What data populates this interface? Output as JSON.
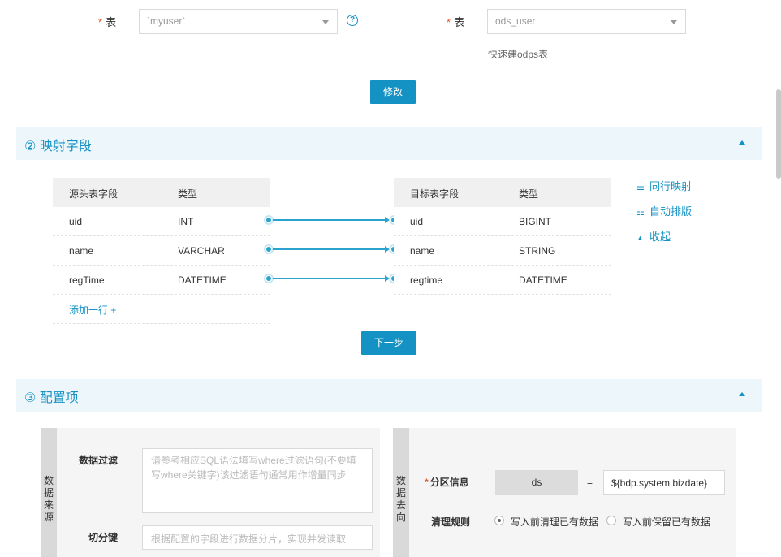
{
  "source": {
    "table_label": "表",
    "table_value": "`myuser`",
    "help_icon": "question-circle-icon"
  },
  "target": {
    "table_label": "表",
    "table_value": "ods_user",
    "quick_create_link": "快速建odps表"
  },
  "modify_button": "修改",
  "section2": {
    "title": "② 映射字段",
    "source_table": {
      "headers": [
        "源头表字段",
        "类型"
      ],
      "rows": [
        {
          "field": "uid",
          "type": "INT"
        },
        {
          "field": "name",
          "type": "VARCHAR"
        },
        {
          "field": "regTime",
          "type": "DATETIME"
        }
      ],
      "add_row": "添加一行 +"
    },
    "target_table": {
      "headers": [
        "目标表字段",
        "类型"
      ],
      "rows": [
        {
          "field": "uid",
          "type": "BIGINT"
        },
        {
          "field": "name",
          "type": "STRING"
        },
        {
          "field": "regtime",
          "type": "DATETIME"
        }
      ]
    },
    "actions": {
      "same_row_mapping": "同行映射",
      "auto_layout": "自动排版",
      "collapse": "收起"
    },
    "next_button": "下一步"
  },
  "section3": {
    "title": "③ 配置项",
    "source_panel": {
      "tab_label": [
        "数",
        "据",
        "来",
        "源"
      ],
      "filter_label": "数据过滤",
      "filter_placeholder": "请参考相应SQL语法填写where过滤语句(不要填写where关键字)该过滤语句通常用作增量同步",
      "split_label": "切分键",
      "split_placeholder": "根据配置的字段进行数据分片，实现并发读取"
    },
    "target_panel": {
      "tab_label": [
        "数",
        "据",
        "去",
        "向"
      ],
      "partition_label": "分区信息",
      "partition_key": "ds",
      "equals": "=",
      "partition_value": "${bdp.system.bizdate}",
      "clean_rule_label": "清理规则",
      "clean_options": [
        {
          "label": "写入前清理已有数据",
          "selected": true
        },
        {
          "label": "写入前保留已有数据",
          "selected": false
        }
      ]
    }
  },
  "colors": {
    "accent": "#1592c4",
    "section_bg": "#edf6fb",
    "required": "#e0572a"
  }
}
